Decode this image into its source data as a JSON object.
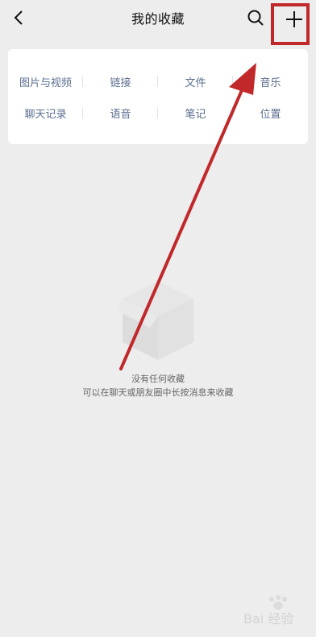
{
  "header": {
    "title": "我的收藏",
    "back_icon": "chevron-left-icon",
    "search_icon": "search-icon",
    "add_icon": "plus-icon"
  },
  "categories": {
    "row1": [
      {
        "label": "图片与视频"
      },
      {
        "label": "链接"
      },
      {
        "label": "文件"
      },
      {
        "label": "音乐"
      }
    ],
    "row2": [
      {
        "label": "聊天记录"
      },
      {
        "label": "语音"
      },
      {
        "label": "笔记"
      },
      {
        "label": "位置"
      }
    ]
  },
  "empty_state": {
    "icon": "empty-box-icon",
    "title": "没有任何收藏",
    "hint": "可以在聊天或朋友圈中长按消息来收藏"
  },
  "annotation": {
    "color": "#c0282a"
  },
  "watermark": {
    "text": "Bai 经验",
    "icon": "baidu-paw-icon"
  }
}
